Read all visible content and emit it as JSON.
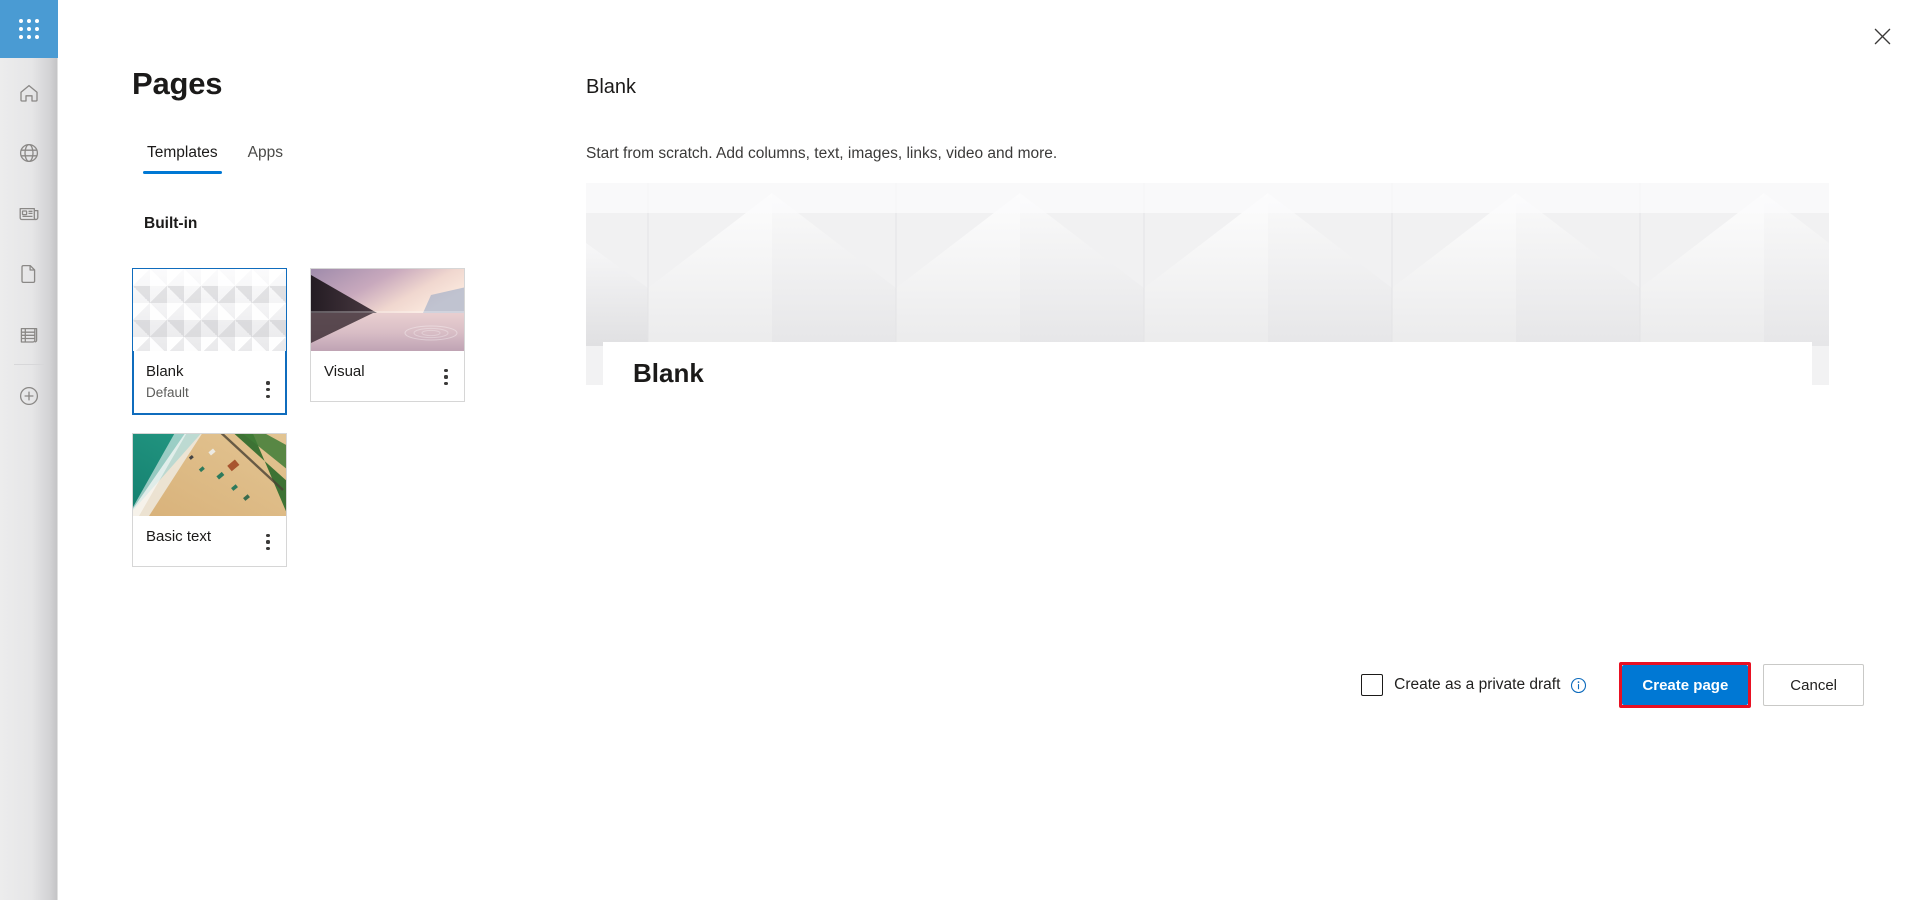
{
  "rail": {
    "items": [
      {
        "name": "app-launcher",
        "icon": "waffle-icon",
        "label": "App launcher"
      },
      {
        "name": "home",
        "icon": "home-icon",
        "label": "Home"
      },
      {
        "name": "web",
        "icon": "globe-icon",
        "label": "Web"
      },
      {
        "name": "news",
        "icon": "news-icon",
        "label": "News"
      },
      {
        "name": "documents",
        "icon": "document-icon",
        "label": "Documents"
      },
      {
        "name": "lists",
        "icon": "list-icon",
        "label": "Lists"
      },
      {
        "name": "create",
        "icon": "plus-circle-icon",
        "label": "Create"
      }
    ]
  },
  "window": {
    "close_icon": "close-icon"
  },
  "left": {
    "title": "Pages",
    "tabs": [
      {
        "label": "Templates",
        "active": true
      },
      {
        "label": "Apps",
        "active": false
      }
    ],
    "section_heading": "Built-in",
    "templates": [
      {
        "name": "Blank",
        "subtitle": "Default",
        "selected": true,
        "thumb": "cubes-pattern",
        "menu_icon": "more-options-icon"
      },
      {
        "name": "Visual",
        "subtitle": "",
        "selected": false,
        "thumb": "sunset-lake",
        "menu_icon": "more-options-icon"
      },
      {
        "name": "Basic text",
        "subtitle": "",
        "selected": false,
        "thumb": "aerial-beach",
        "menu_icon": "more-options-icon"
      }
    ]
  },
  "detail": {
    "title": "Blank",
    "description": "Start from scratch. Add columns, text, images, links, video and more.",
    "preview_card_title": "Blank"
  },
  "footer": {
    "private_draft_label": "Create as a private draft",
    "private_draft_checked": false,
    "info_icon": "info-icon",
    "primary_button": "Create page",
    "secondary_button": "Cancel"
  },
  "colors": {
    "accent": "#0078d4",
    "waffle_blue": "#4a9bd3",
    "highlight_red": "#e81123",
    "selected_border": "#0f6cbd"
  }
}
